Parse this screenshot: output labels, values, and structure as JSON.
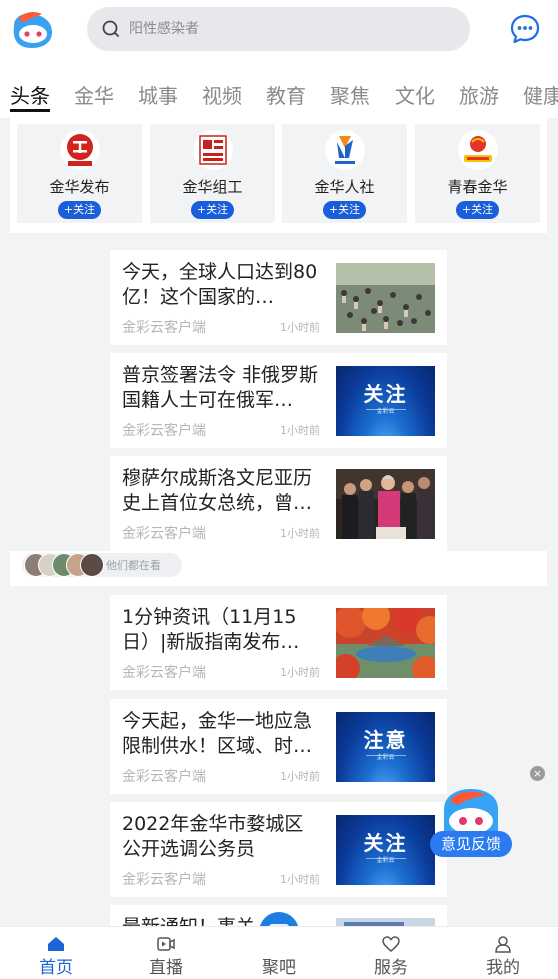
{
  "header": {
    "search": {
      "placeholder": "阳性感染者"
    },
    "tabs": [
      {
        "label": "头条",
        "active": true
      },
      {
        "label": "金华"
      },
      {
        "label": "城事"
      },
      {
        "label": "视频"
      },
      {
        "label": "教育"
      },
      {
        "label": "聚焦"
      },
      {
        "label": "文化"
      },
      {
        "label": "旅游"
      },
      {
        "label": "健康"
      }
    ]
  },
  "subscriptions": [
    {
      "name": "金华发布",
      "follow": "+关注",
      "logo_text": "金华发布"
    },
    {
      "name": "金华组工",
      "follow": "+关注",
      "logo_text": "金华组工"
    },
    {
      "name": "金华人社",
      "follow": "+关注",
      "logo_text": "金华人社"
    },
    {
      "name": "青春金华",
      "follow": "+关注",
      "logo_text": "青春金华"
    }
  ],
  "news": [
    {
      "title": "今天，全球人口达到80亿！这个国家的…",
      "source": "金彩云客户端",
      "time": "1小时前",
      "thumb": "crowd-photo"
    },
    {
      "title": "普京签署法令 非俄罗斯国籍人士可在俄军…",
      "source": "金彩云客户端",
      "time": "1小时前",
      "thumb": "blue",
      "thumb_text": "关注",
      "thumb_sub": "金彩云"
    },
    {
      "title": "穆萨尔成斯洛文尼亚历史上首位女总统，曾…",
      "source": "金彩云客户端",
      "time": "1小时前",
      "thumb": "people-photo"
    },
    {
      "title": "1分钟资讯（11月15日）|新版指南发布…",
      "source": "金彩云客户端",
      "time": "1小时前",
      "thumb": "autumn-photo"
    },
    {
      "title": "今天起，金华一地应急限制供水！区域、时…",
      "source": "金彩云客户端",
      "time": "1小时前",
      "thumb": "blue",
      "thumb_text": "注意",
      "thumb_sub": "金彩云"
    },
    {
      "title": "2022年金华市婺城区公开选调公务员",
      "source": "金彩云客户端",
      "time": "1小时前",
      "thumb": "blue",
      "thumb_text": "关注",
      "thumb_sub": "金彩云"
    },
    {
      "title": "最新通知！事关",
      "source": "",
      "time": "",
      "thumb": "doc-photo"
    }
  ],
  "watching": {
    "text": "他们都在看"
  },
  "feedback": {
    "label": "意见反馈",
    "close": "×"
  },
  "bottom_nav": [
    {
      "label": "首页",
      "icon": "home-icon",
      "active": true
    },
    {
      "label": "直播",
      "icon": "video-icon"
    },
    {
      "label": "聚吧",
      "icon": "chat-icon"
    },
    {
      "label": "服务",
      "icon": "heart-icon"
    },
    {
      "label": "我的",
      "icon": "user-icon"
    }
  ],
  "colors": {
    "accent": "#1a5fd9",
    "active_tab": "#111111",
    "background": "#f2f3f5"
  }
}
